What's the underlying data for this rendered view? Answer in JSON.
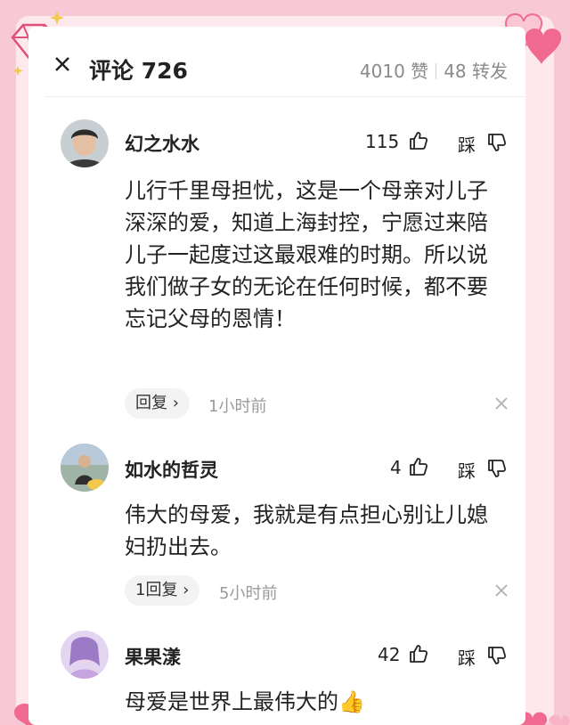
{
  "header": {
    "title": "评论 726",
    "likes": "4010 赞",
    "shares": "48 转发"
  },
  "comments": [
    {
      "username": "幻之水水",
      "like_count": "115",
      "dislike_label": "踩",
      "text": "儿行千里母担忧，这是一个母亲对儿子深深的爱，知道上海封控，宁愿过来陪儿子一起度过这最艰难的时期。所以说我们做子女的无论在任何时候，都不要忘记父母的恩情！",
      "reply_label": "回复 ›",
      "time": "1小时前"
    },
    {
      "username": "如水的哲灵",
      "like_count": "4",
      "dislike_label": "踩",
      "text": "伟大的母爱，我就是有点担心别让儿媳妇扔出去。",
      "reply_label": "1回复 ›",
      "time": "5小时前"
    },
    {
      "username": "果果漾",
      "like_count": "42",
      "dislike_label": "踩",
      "text": "母爱是世界上最伟大的👍"
    }
  ],
  "colors": {
    "frame": "#f7c9d6",
    "heart": "#f06a8f",
    "card": "#ffffff"
  }
}
